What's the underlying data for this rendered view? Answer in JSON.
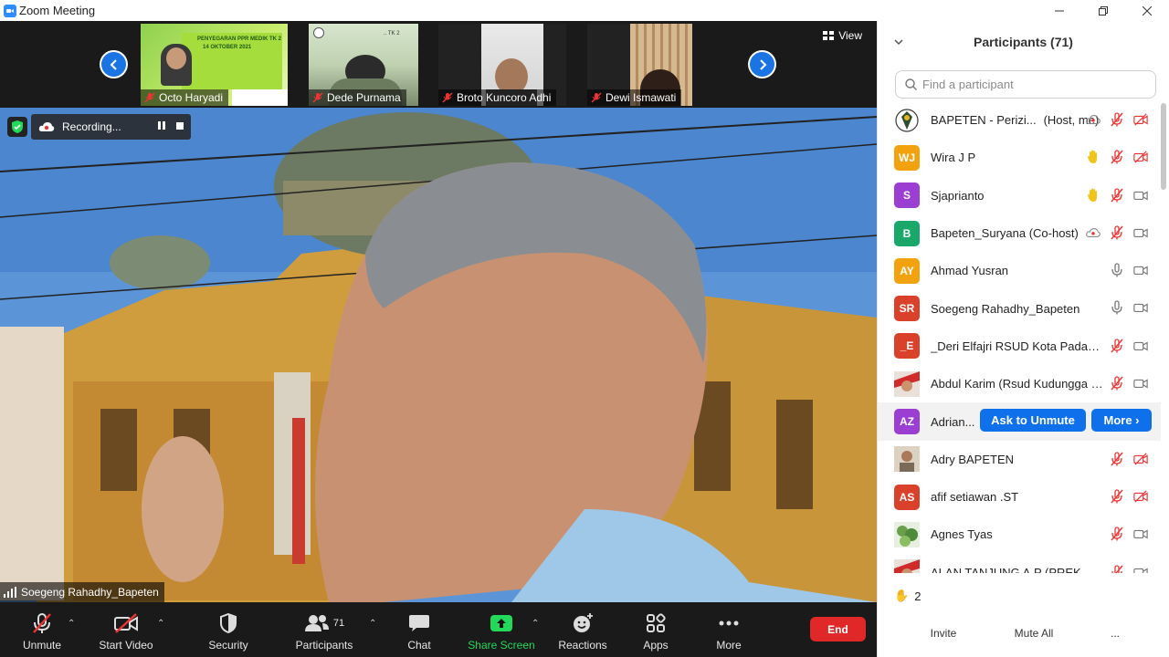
{
  "window": {
    "title": "Zoom Meeting"
  },
  "strip": {
    "view_label": "View",
    "thumbs": [
      {
        "name": "Octo Haryadi",
        "banner1": "PENYEGARAN PPR MEDIK TK 2",
        "banner2": "14 OKTOBER 2021"
      },
      {
        "name": "Dede Purnama",
        "banner1": ".. TK 2"
      },
      {
        "name": "Broto Kuncoro Adhi"
      },
      {
        "name": "Dewi Ismawati"
      }
    ]
  },
  "recording": {
    "label": "Recording..."
  },
  "active_speaker": {
    "name": "Soegeng Rahadhy_Bapeten"
  },
  "toolbar": {
    "unmute": "Unmute",
    "start_video": "Start Video",
    "security": "Security",
    "participants": "Participants",
    "participants_count": "71",
    "chat": "Chat",
    "share_screen": "Share Screen",
    "reactions": "Reactions",
    "apps": "Apps",
    "more": "More",
    "end": "End"
  },
  "panel": {
    "title": "Participants (71)",
    "search_placeholder": "Find a participant",
    "raised_hands": "2",
    "buttons": {
      "invite": "Invite",
      "mute_all": "Mute All",
      "more": "..."
    },
    "row_actions": {
      "ask_unmute": "Ask to Unmute",
      "more": "More ›"
    },
    "participants": [
      {
        "initials": "",
        "name": "BAPETEN - Perizi...",
        "role": "(Host, me)",
        "color": "#ffffff",
        "avatar": "logo",
        "icons": [
          "rec",
          "mic-off",
          "video-off"
        ]
      },
      {
        "initials": "WJ",
        "name": "Wira J P",
        "role": "",
        "color": "#f2a10f",
        "icons": [
          "hand",
          "mic-off",
          "video-off"
        ]
      },
      {
        "initials": "S",
        "name": "Sjaprianto",
        "role": "",
        "color": "#9b3fd2",
        "icons": [
          "hand",
          "mic-off",
          "video"
        ]
      },
      {
        "initials": "B",
        "name": "Bapeten_Suryana (Co-host)",
        "role": "",
        "color": "#1aa86a",
        "icons": [
          "rec",
          "mic-off",
          "video"
        ]
      },
      {
        "initials": "AY",
        "name": "Ahmad Yusran",
        "role": "",
        "color": "#f2a10f",
        "icons": [
          "mic",
          "video"
        ]
      },
      {
        "initials": "SR",
        "name": "Soegeng Rahadhy_Bapeten",
        "role": "",
        "color": "#d9412b",
        "icons": [
          "mic",
          "video"
        ]
      },
      {
        "initials": "_E",
        "name": "_Deri Elfajri RSUD Kota Padang ...",
        "role": "",
        "color": "#d9412b",
        "icons": [
          "mic-off",
          "video"
        ]
      },
      {
        "initials": "",
        "name": "Abdul Karim (Rsud Kudungga K...",
        "role": "",
        "color": "#e8e8e8",
        "avatar": "photo-red",
        "icons": [
          "mic-off",
          "video"
        ]
      },
      {
        "initials": "AZ",
        "name": "Adrian...",
        "role": "",
        "color": "#9b3fd2",
        "icons": [],
        "hover": true
      },
      {
        "initials": "",
        "name": "Adry BAPETEN",
        "role": "",
        "color": "#d8c9b4",
        "avatar": "photo-tan",
        "icons": [
          "mic-off",
          "video-off"
        ]
      },
      {
        "initials": "AS",
        "name": "afif setiawan .ST",
        "role": "",
        "color": "#d9412b",
        "icons": [
          "mic-off",
          "video-off"
        ]
      },
      {
        "initials": "",
        "name": "Agnes Tyas",
        "role": "",
        "color": "#8fb573",
        "avatar": "photo-green",
        "icons": [
          "mic-off",
          "video"
        ]
      },
      {
        "initials": "",
        "name": "ALAN TANJUNG A.P (PREK Mak...",
        "role": "",
        "color": "#d9412b",
        "avatar": "photo-red",
        "icons": [
          "mic-off",
          "video"
        ]
      }
    ]
  },
  "colors": {
    "accent": "#0e71eb",
    "end": "#e02828",
    "share": "#23d959",
    "toolbar": "#1a1a1a"
  }
}
